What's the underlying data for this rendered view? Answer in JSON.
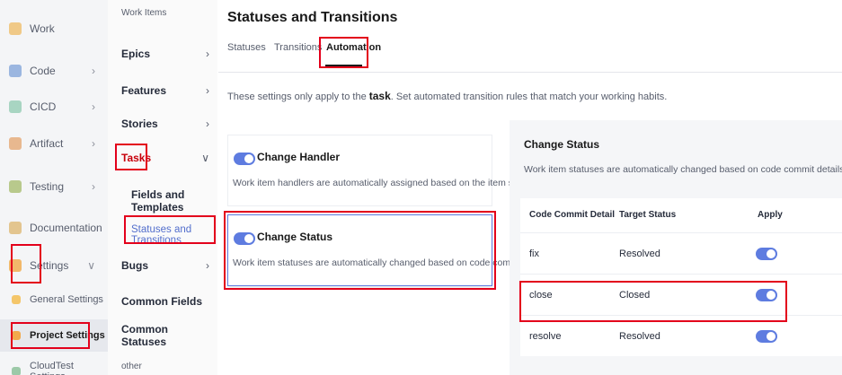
{
  "leftnav": {
    "items": [
      {
        "label": "Work",
        "icon": "work-icon",
        "chevron": ""
      },
      {
        "label": "Code",
        "icon": "code-icon",
        "chevron": "›"
      },
      {
        "label": "CICD",
        "icon": "cicd-icon",
        "chevron": "›"
      },
      {
        "label": "Artifact",
        "icon": "artifact-icon",
        "chevron": "›"
      },
      {
        "label": "Testing",
        "icon": "testing-icon",
        "chevron": "›"
      },
      {
        "label": "Documentation",
        "icon": "documentation-icon",
        "chevron": ""
      },
      {
        "label": "Settings",
        "icon": "settings-icon",
        "chevron": "∨"
      },
      {
        "label": "General Settings",
        "icon": "general-settings-icon",
        "chevron": ""
      },
      {
        "label": "Project Settings",
        "icon": "project-settings-icon",
        "chevron": ""
      },
      {
        "label": "CloudTest Settings",
        "icon": "cloudtest-settings-icon",
        "chevron": ""
      }
    ]
  },
  "subnav": {
    "header": "Work Items",
    "items": {
      "epics": "Epics",
      "features": "Features",
      "stories": "Stories",
      "tasks": "Tasks",
      "fields_templates": "Fields and Templates",
      "statuses_transitions": "Statuses and Transitions",
      "bugs": "Bugs",
      "common_fields": "Common Fields",
      "common_statuses": "Common Statuses",
      "other": "other"
    },
    "chev_right": "›",
    "chev_down": "∨"
  },
  "main": {
    "title": "Statuses and Transitions",
    "tabs": [
      "Statuses",
      "Transitions",
      "Automation"
    ],
    "notice_prefix": "These settings only apply to the ",
    "notice_bold": "task",
    "notice_suffix": ". Set automated transition rules that match your working habits."
  },
  "cards": [
    {
      "title": "Change Handler",
      "desc": "Work item handlers are automatically assigned based on the item status.",
      "enabled": true
    },
    {
      "title": "Change Status",
      "desc": "Work item statuses are automatically changed based on code commit details.",
      "enabled": true
    }
  ],
  "change_status_panel": {
    "title": "Change Status",
    "desc": "Work item statuses are automatically changed based on code commit details.",
    "columns": [
      "Code Commit Detail",
      "Target Status",
      "Apply"
    ],
    "rows": [
      {
        "detail": "fix",
        "target": "Resolved",
        "apply": true
      },
      {
        "detail": "close",
        "target": "Closed",
        "apply": true
      },
      {
        "detail": "resolve",
        "target": "Resolved",
        "apply": true
      }
    ]
  },
  "colors": {
    "accent": "#5e7ce0",
    "highlight": "#e3001b",
    "selected_link": "#526ecc"
  }
}
